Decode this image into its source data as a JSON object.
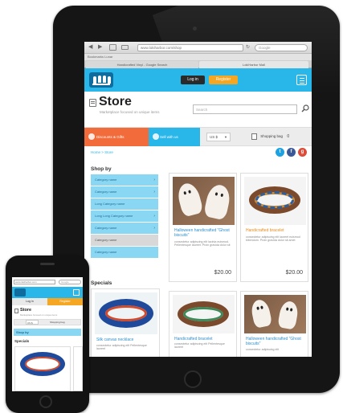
{
  "tablet": {
    "browser": {
      "back": "◀",
      "forward": "▶",
      "url": "www.lokiharbor.com/shop",
      "search_placeholder": "Google",
      "bookmark_bar": "Bookmarks Lunar",
      "tabs": [
        "Handicrafted Vinyl - Google Search",
        "LokiHarbor Mall"
      ]
    },
    "header": {
      "login": "Log in",
      "register": "Register"
    },
    "title": "Store",
    "subtitle": "Marketplace focused on unique items",
    "search_placeholder": "Search",
    "toolbar": {
      "discounts": "Discounts & Gifts",
      "sell": "Sell with us",
      "currency": "US $",
      "bag": "Shopping bag",
      "bag_count": "0"
    },
    "breadcrumb": "Home  >  Store",
    "social": [
      "t",
      "f",
      "g"
    ],
    "sidebar": {
      "heading": "Shop by",
      "categories": [
        {
          "label": "Category name",
          "arrow": "›"
        },
        {
          "label": "Category name",
          "arrow": "›"
        },
        {
          "label": "Long Category name",
          "arrow": ""
        },
        {
          "label": "Long Long Category name",
          "arrow": "›"
        },
        {
          "label": "Category name",
          "arrow": "›"
        },
        {
          "label": "Category name",
          "arrow": ""
        },
        {
          "label": "Category name",
          "arrow": ""
        }
      ],
      "specials": "Specials"
    },
    "products": [
      {
        "name": "Halloween handicrafted \"Ghost biscuits\"",
        "desc": "consectetur adipiscing elit lacinia euismod. Pellentesque laoreet. Proin gravida dolor sit",
        "price": "$20.00"
      },
      {
        "name": "Handicrafted bracelet",
        "desc": "consectetur adipiscing elit laoreet euismod bibendum. Proin gravida dolor sit amet",
        "price": "$20.00"
      },
      {
        "name": "Silk canvas necklace",
        "desc": "consectetur adipiscing elit Pellentesque laoreet"
      },
      {
        "name": "Handicrafted bracelet",
        "desc": "consectetur adipiscing elit Pellentesque laoreet"
      },
      {
        "name": "Halloween handicrafted \"Ghost biscuits\"",
        "desc": "consectetur adipiscing elit"
      }
    ]
  },
  "phone": {
    "url": "www.lokiharbor.com",
    "search": "Google",
    "login": "Log in",
    "register": "Register",
    "title": "Store",
    "subtitle": "Marketplace focused on unique items",
    "currency": "US $",
    "bag": "Shopping bag",
    "shopby": "Shop by",
    "specials": "Specials"
  },
  "colors": {
    "brand_blue": "#29b6e9",
    "brand_orange": "#f5a623",
    "discount_red": "#f26b3a",
    "category_blue": "#8ad7f4"
  }
}
